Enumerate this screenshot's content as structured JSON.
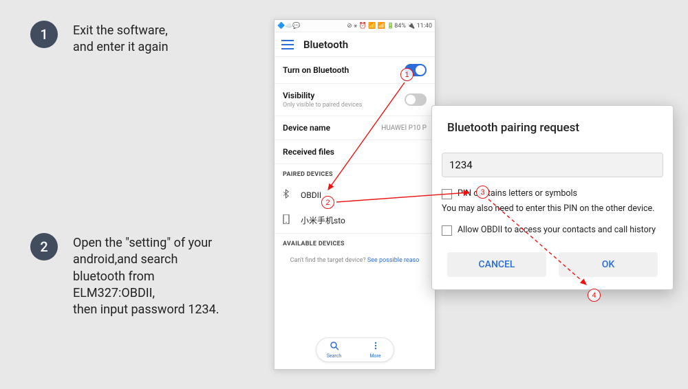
{
  "steps": [
    {
      "num": "1",
      "text": "Exit the software,\nand enter it again"
    },
    {
      "num": "2",
      "text": "Open the \"setting\" of your\nandroid,and search\nbluetooth from\nELM327:OBDII,\nthen input password 1234."
    }
  ],
  "statusbar": {
    "left": "🔷☁️💬",
    "right": "⊘ ⚹ ⏰ 📶 📶 🔋84% 🔌 11:40"
  },
  "appbar": {
    "title": "Bluetooth"
  },
  "rows": {
    "bt_toggle": "Turn on Bluetooth",
    "visibility": {
      "label": "Visibility",
      "sub": "Only visible to paired devices"
    },
    "device_name": {
      "label": "Device name",
      "value": "HUAWEI P10 P"
    },
    "received": "Received files"
  },
  "sections": {
    "paired": "PAIRED DEVICES",
    "available": "AVAILABLE DEVICES"
  },
  "devices": [
    {
      "icon": "bt",
      "name": "OBDII"
    },
    {
      "icon": "phone",
      "name": "小米手机sto"
    }
  ],
  "helper": {
    "text": "Can't find the target device? ",
    "link": "See possible reaso"
  },
  "bottombar": {
    "search": "Search",
    "more": "More"
  },
  "dialog": {
    "title": "Bluetooth pairing request",
    "pin": "1234",
    "check1": "PIN contains letters or symbols",
    "note": "You may also need to enter this PIN on the other device.",
    "check2": "Allow OBDII to access your contacts and call history",
    "cancel": "CANCEL",
    "ok": "OK"
  },
  "annotations": [
    "1",
    "2",
    "3",
    "4"
  ]
}
